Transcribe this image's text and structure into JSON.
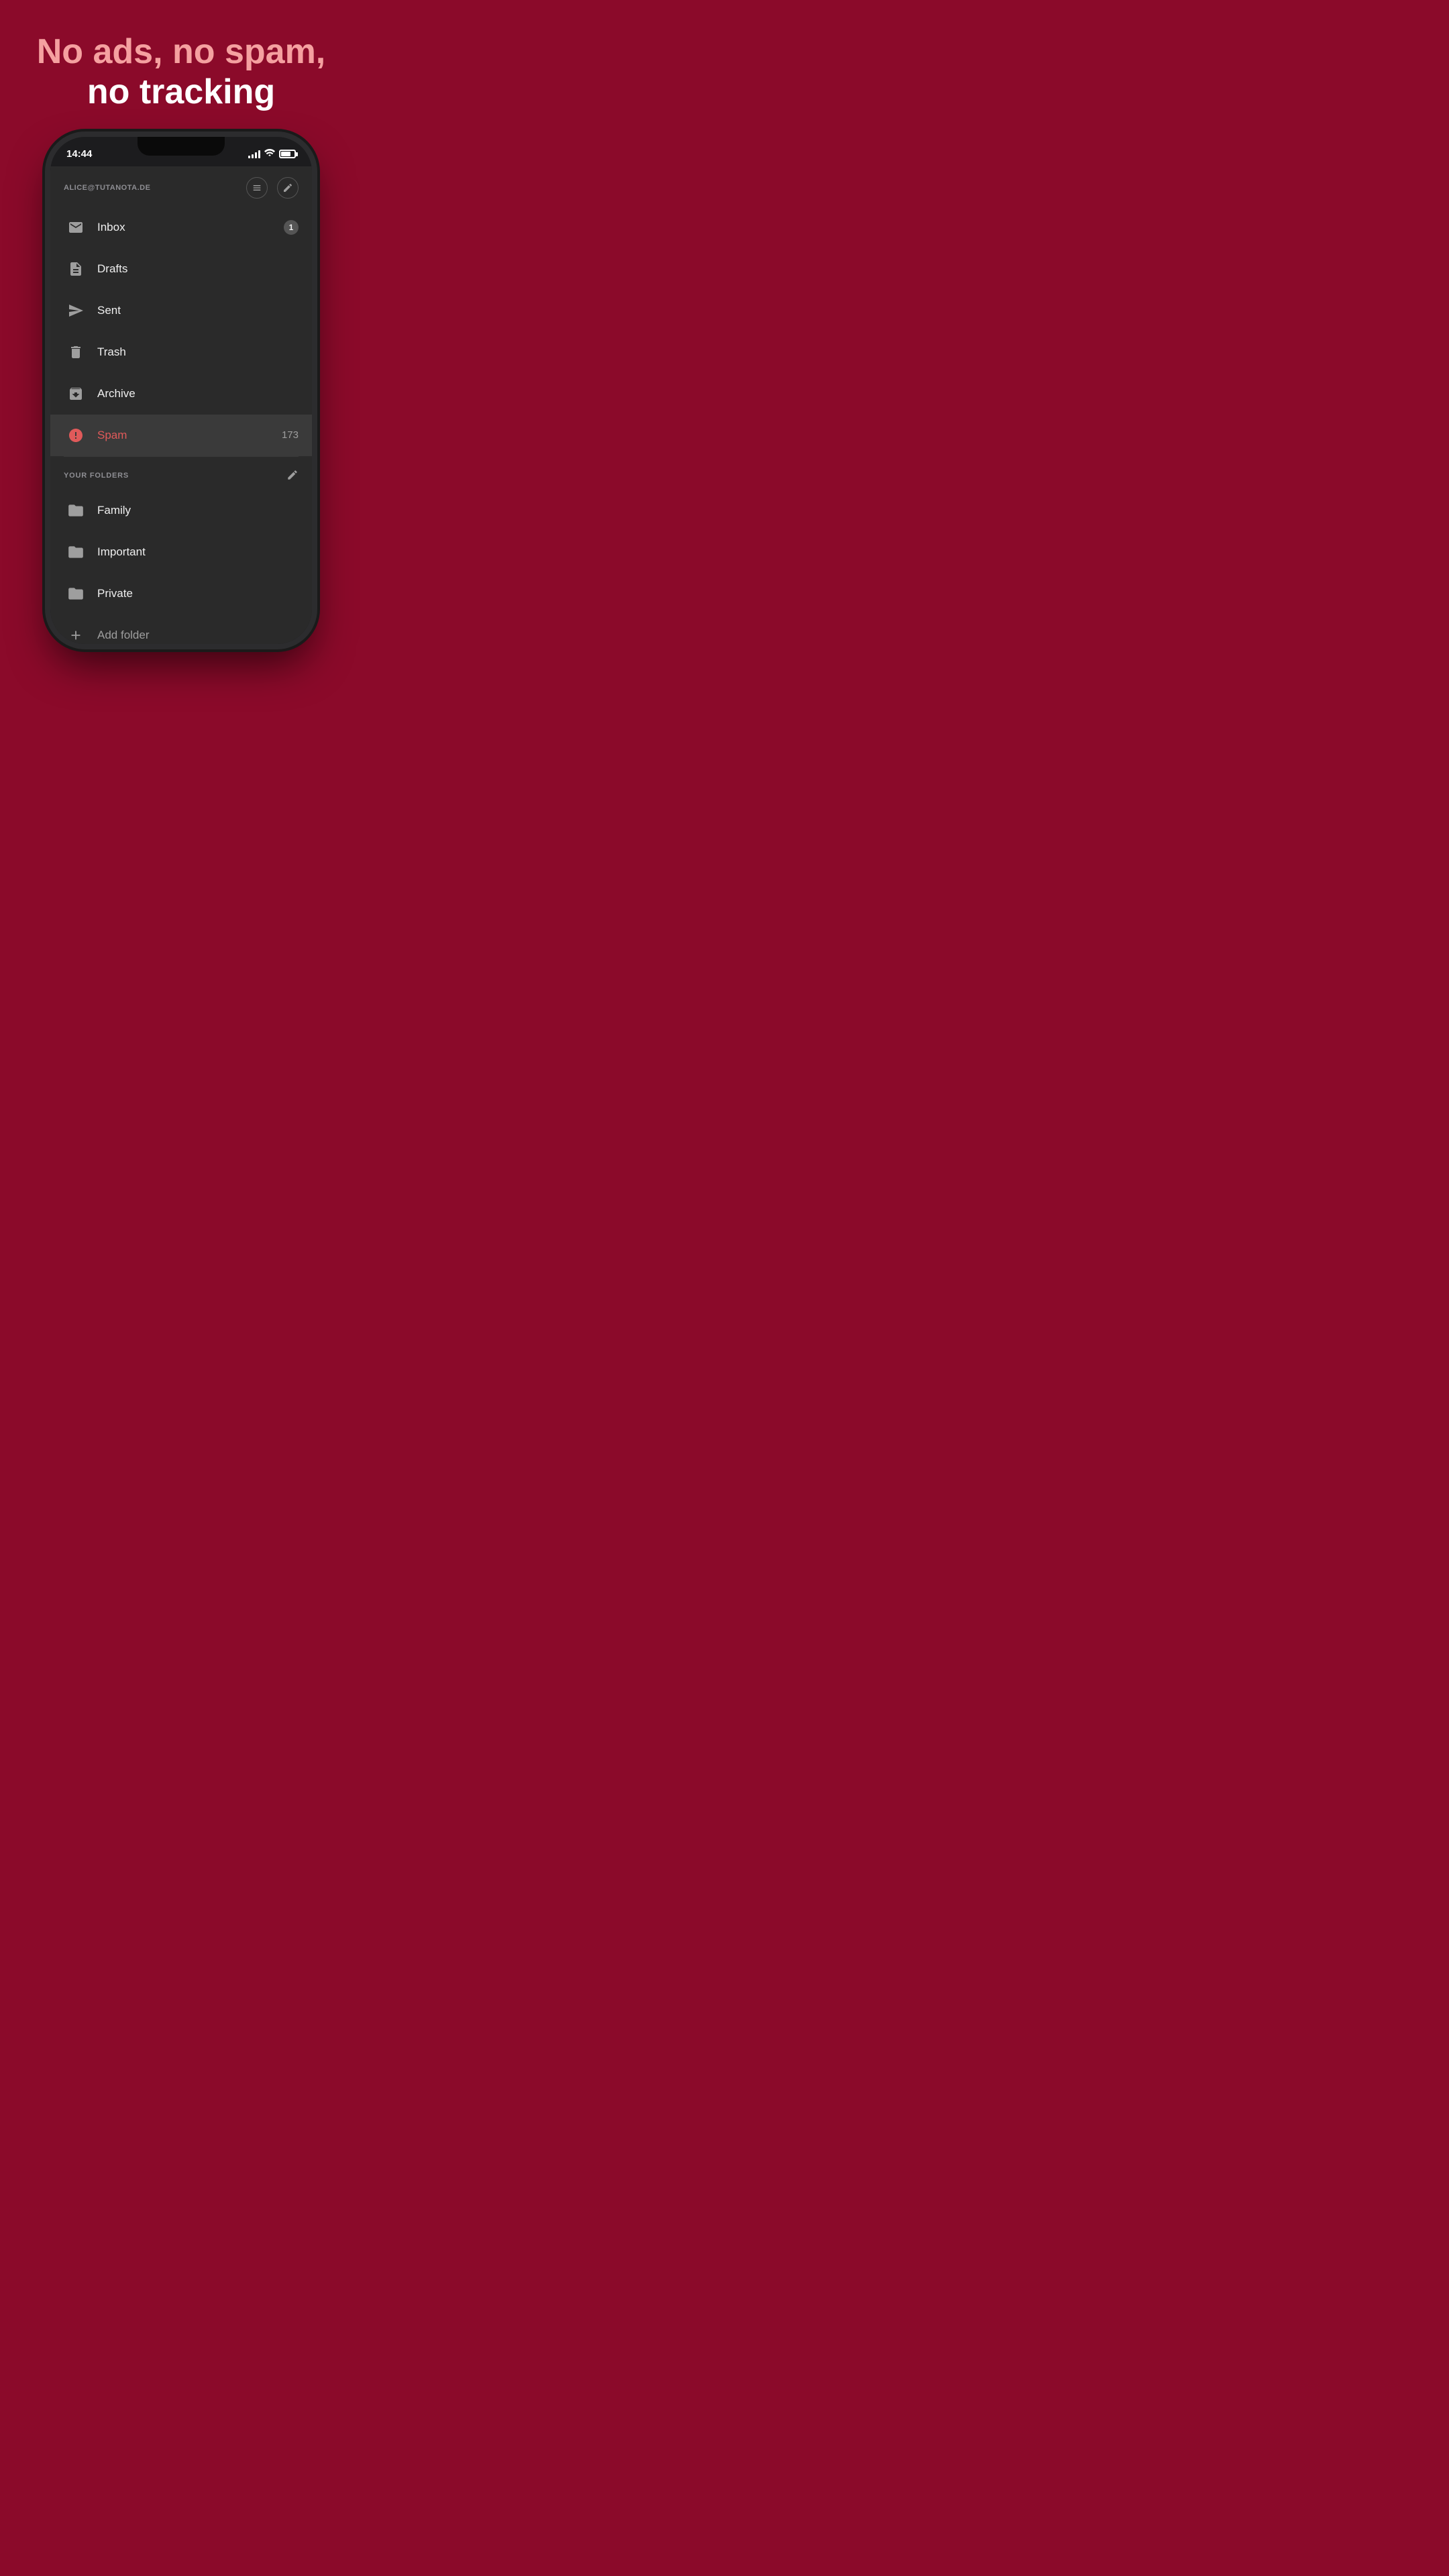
{
  "headline": {
    "line1": "No ads, no spam,",
    "line2": "no tracking"
  },
  "status_bar": {
    "time": "14:44",
    "battery_level": 75
  },
  "header": {
    "account": "ALICE@TUTANOTA.DE",
    "actions_icon1": "list-check-icon",
    "actions_icon2": "compose-icon"
  },
  "nav_items": [
    {
      "id": "inbox",
      "label": "Inbox",
      "icon": "inbox-icon",
      "badge": "1",
      "active": false
    },
    {
      "id": "drafts",
      "label": "Drafts",
      "icon": "drafts-icon",
      "badge": null,
      "active": false
    },
    {
      "id": "sent",
      "label": "Sent",
      "icon": "sent-icon",
      "badge": null,
      "active": false
    },
    {
      "id": "trash",
      "label": "Trash",
      "icon": "trash-icon",
      "badge": null,
      "active": false
    },
    {
      "id": "archive",
      "label": "Archive",
      "icon": "archive-icon",
      "badge": null,
      "active": false
    },
    {
      "id": "spam",
      "label": "Spam",
      "icon": "spam-icon",
      "badge": "173",
      "active": true
    }
  ],
  "folders_section": {
    "title": "YOUR FOLDERS",
    "edit_label": "Edit"
  },
  "folders": [
    {
      "id": "family",
      "label": "Family"
    },
    {
      "id": "important",
      "label": "Important"
    },
    {
      "id": "private",
      "label": "Private"
    }
  ],
  "add_folder": {
    "label": "Add folder"
  }
}
